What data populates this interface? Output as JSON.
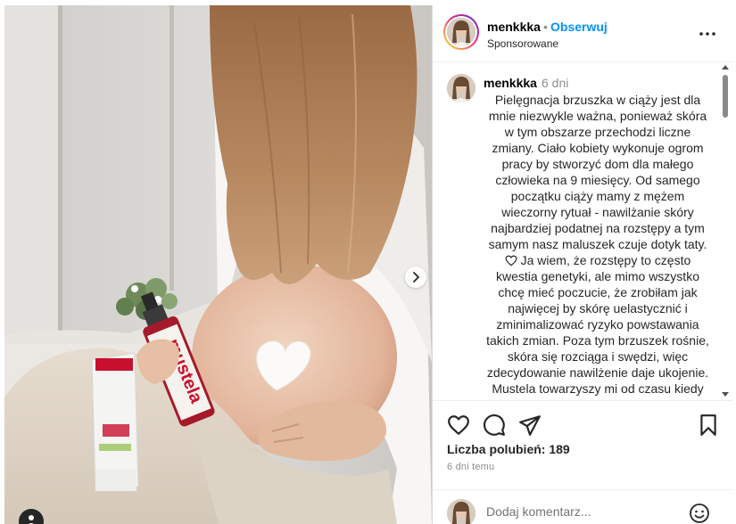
{
  "post": {
    "username": "menkkka",
    "follow_separator": "•",
    "follow_label": "Obserwuj",
    "sponsored_label": "Sponsorowane",
    "more_icon": "more-horizontal-icon"
  },
  "caption": {
    "username": "menkkka",
    "time_ago": "6 dni",
    "text_part1": "Pielęgnacja brzuszka w ciąży jest dla mnie niezwykle ważna, ponieważ skóra w tym obszarze przechodzi liczne zmiany. Ciało kobiety wykonuje ogrom pracy by stworzyć dom dla małego człowieka na 9 miesięcy. Od samego początku ciąży mamy z mężem wieczorny rytuał - nawilżanie skóry najbardziej podatnej na rozstępy a tym samym nasz maluszek czuje dotyk taty.",
    "heart_icon": "heart-outline-icon",
    "text_part2": " Ja wiem, że rozstępy to często kwestia genetyki, ale mimo wszystko chcę mieć poczucie, że zrobiłam jak najwięcej by skórę uelastycznić i zminimalizować ryzyko powstawania takich zmian. Poza tym brzuszek rośnie, skóra się rozciąga i swędzi, więc zdecydowanie nawilżenie daje ukojenie. Mustela towarzyszy mi od czasu kiedy"
  },
  "photo": {
    "product_label": "mustela",
    "next_icon": "chevron-right-icon",
    "tag_icon": "user-tag-icon"
  },
  "actions": {
    "like_icon": "heart-icon",
    "comment_icon": "comment-icon",
    "share_icon": "send-icon",
    "save_icon": "bookmark-icon",
    "likes_label": "Liczba polubień: 189",
    "posted_ago": "6 dni temu"
  },
  "comment_box": {
    "placeholder": "Dodaj komentarz...",
    "emoji_icon": "emoji-icon"
  },
  "colors": {
    "link_blue": "#0095f6",
    "text_primary": "#262626",
    "text_secondary": "#8e8e8e",
    "border": "#dbdbdb",
    "product_red": "#c8102e"
  }
}
